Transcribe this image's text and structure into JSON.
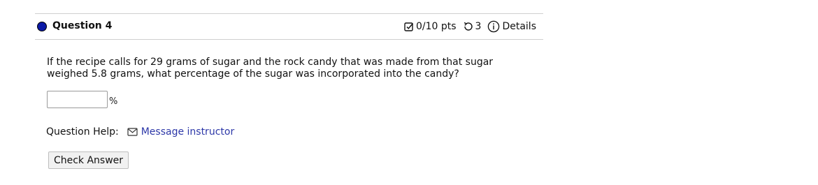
{
  "question": {
    "title": "Question 4",
    "status_color": "#0b1aa6",
    "score": "0/10 pts",
    "attempts": "3",
    "details_label": "Details",
    "text": "If the recipe calls for 29 grams of sugar and the rock candy that was made from that sugar weighed 5.8 grams, what percentage of the sugar was incorporated into the candy?",
    "answer_value": "",
    "unit": "%"
  },
  "help": {
    "label": "Question Help:",
    "message_link": "Message instructor",
    "link_color": "#2d38a8"
  },
  "actions": {
    "check_label": "Check Answer"
  },
  "icons": {
    "score": "checkbox-icon",
    "attempts": "retry-icon",
    "details": "info-icon",
    "message": "mail-icon"
  }
}
